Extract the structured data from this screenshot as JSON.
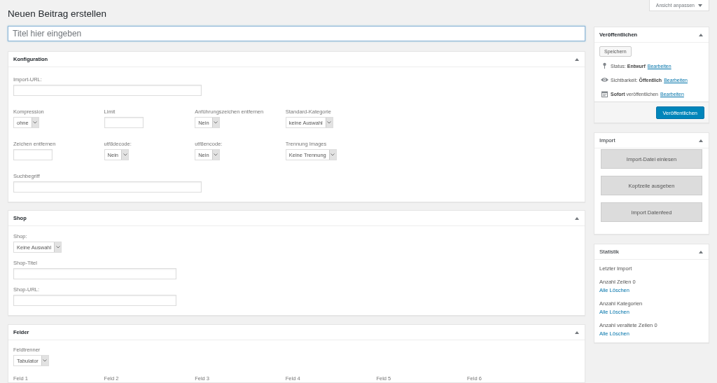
{
  "screen_options": {
    "label": "Ansicht anpassen"
  },
  "heading": "Neuen Beitrag erstellen",
  "title_field": {
    "placeholder": "Titel hier eingeben"
  },
  "panels": [
    {
      "title": "Konfiguration",
      "rows": [
        [
          {
            "label": "Import-URL:",
            "kind": "text"
          }
        ],
        [
          {
            "label": "Kompression",
            "kind": "select",
            "value": "ohne"
          },
          {
            "label": "Limit",
            "kind": "text"
          },
          {
            "label": "Anführungszeichen entfernen",
            "kind": "select",
            "value": "Nein"
          },
          {
            "label": "Standard-Kategorie",
            "kind": "select",
            "value": "keine Auswahl"
          }
        ],
        [
          {
            "label": "Zeichen entfernen",
            "kind": "text"
          },
          {
            "label": "utf8decode:",
            "kind": "select",
            "value": "Nein"
          },
          {
            "label": "utf8encode:",
            "kind": "select",
            "value": "Nein"
          },
          {
            "label": "Trennung Images",
            "kind": "select",
            "value": "Keine Trennung"
          }
        ],
        [
          {
            "label": "Suchbegriff",
            "kind": "text"
          }
        ]
      ]
    },
    {
      "title": "Shop",
      "rows": [
        [
          {
            "label": "Shop:",
            "kind": "select",
            "value": "Keine Auswahl"
          }
        ],
        [
          {
            "label": "Shop-Titel",
            "kind": "text"
          }
        ],
        [
          {
            "label": "Shop-URL:",
            "kind": "text"
          }
        ]
      ]
    },
    {
      "title": "Felder",
      "rows": [
        [
          {
            "label": "Feldtrenner",
            "kind": "select",
            "value": "Tabulator"
          }
        ],
        [
          {
            "label": "Feld 1"
          },
          {
            "label": "Feld 2"
          },
          {
            "label": "Feld 3"
          },
          {
            "label": "Feld 4"
          },
          {
            "label": "Feld 5"
          },
          {
            "label": "Feld 6"
          }
        ]
      ]
    }
  ],
  "publish": {
    "title": "Veröffentlichen",
    "save_button": "Speichern",
    "items": [
      {
        "kind": "status",
        "text": "Status: **Entwurf**",
        "link": "Bearbeiten"
      },
      {
        "kind": "visibility",
        "text": "Sichtbarkeit: **Öffentlich**",
        "link": "Bearbeiten"
      },
      {
        "kind": "schedule",
        "text": "**Sofort** veröffentlichen",
        "link": "Bearbeiten"
      }
    ],
    "publish_button": "Veröffentlichen"
  },
  "import": {
    "title": "Import",
    "buttons": [
      "Import-Datei einlesen",
      "Kopfzeile ausgeben",
      "Import Datenfeed"
    ]
  },
  "statistics": {
    "title": "Statistik",
    "items": [
      {
        "text": "Letzter Import"
      },
      {
        "text": "Anzahl Zeilen 0",
        "link": "Alle Löschen"
      },
      {
        "text": "Anzahl Kategorien",
        "link": "Alle Löschen"
      },
      {
        "text": "Anzahl veraltete Zeilen 0",
        "link": "Alle Löschen"
      }
    ]
  }
}
